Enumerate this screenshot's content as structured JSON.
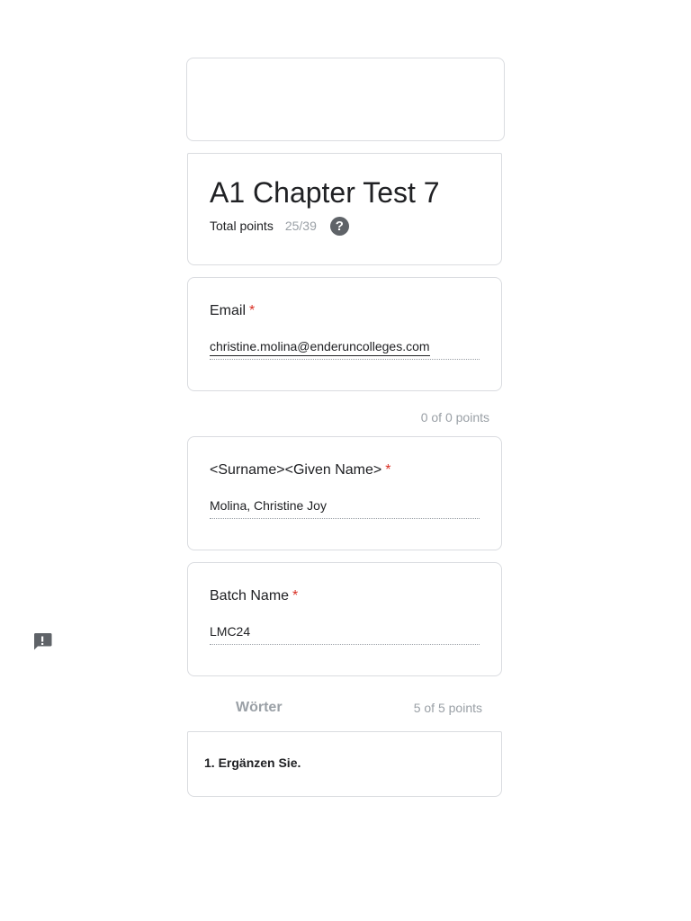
{
  "form": {
    "title": "A1 Chapter Test 7",
    "total_points_label": "Total points",
    "total_points_value": "25/39"
  },
  "questions": [
    {
      "label": "Email",
      "required_mark": "*",
      "answer": "christine.molina@enderuncolleges.com",
      "points": "0 of 0 points"
    },
    {
      "label": "<Surname><Given Name>",
      "required_mark": "*",
      "answer": "Molina, Christine Joy"
    },
    {
      "label": "Batch Name",
      "required_mark": "*",
      "answer": "LMC24"
    }
  ],
  "section": {
    "title": "Wörter",
    "points": "5 of 5 points",
    "first_question": "1. Ergänzen Sie."
  },
  "colors": {
    "required": "#d93025",
    "muted": "#9aa0a6",
    "border": "#dadce0"
  },
  "icons": {
    "help": "help-circle-icon",
    "feedback": "report-feedback-icon"
  }
}
